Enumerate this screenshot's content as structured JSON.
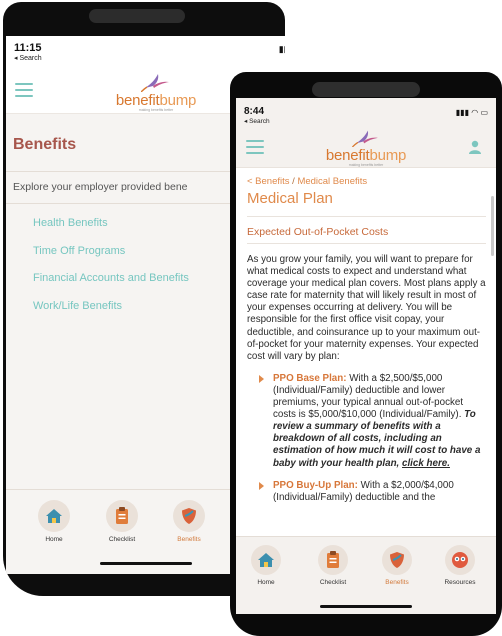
{
  "back_screen": {
    "status": {
      "time": "11:15",
      "back_label": "◂ Search"
    },
    "brand": {
      "name_part1": "benefit",
      "name_part2": "bump",
      "tagline": "making benefits better"
    },
    "page_title": "Benefits",
    "intro": "Explore your employer provided bene",
    "menu_items": [
      "Health Benefits",
      "Time Off Programs",
      "Financial Accounts and Benefits",
      "Work/Life Benefits"
    ],
    "tabs": [
      {
        "label": "Home",
        "icon": "house-icon"
      },
      {
        "label": "Checklist",
        "icon": "clipboard-icon"
      },
      {
        "label": "Benefits",
        "icon": "shield-icon",
        "active": true
      }
    ]
  },
  "front_screen": {
    "status": {
      "time": "8:44",
      "back_label": "◂ Search"
    },
    "brand": {
      "name_part1": "benefit",
      "name_part2": "bump",
      "tagline": "making benefits better"
    },
    "breadcrumb": {
      "parent": "< Benefits",
      "separator": "/",
      "current": "Medical Benefits"
    },
    "page_title": "Medical Plan",
    "section_title": "Expected Out-of-Pocket Costs",
    "paragraph": "As you grow your family, you will want to prepare for what medical costs to expect and understand what coverage your medical plan covers. Most plans apply a case rate for maternity that will likely result in most of your expenses occurring at delivery. You will be responsible for the first office visit copay, your deductible, and coinsurance up to your maximum out-of-pocket for your maternity expenses. Your expected cost will vary by plan:",
    "plans": [
      {
        "name": "PPO Base Plan:",
        "text": " With a $2,500/$5,000 (Individual/Family) deductible and lower premiums, your typical annual out-of-pocket costs is $5,000/$10,000 (Individual/Family). ",
        "emphasis": "To review a summary of benefits with a breakdown of all costs, including an estimation of how much it will cost to have a baby with your health plan, ",
        "link": "click here."
      },
      {
        "name": "PPO Buy-Up Plan:",
        "text": " With a $2,000/$4,000 (Individual/Family) deductible and the"
      }
    ],
    "tabs": [
      {
        "label": "Home",
        "icon": "house-icon"
      },
      {
        "label": "Checklist",
        "icon": "clipboard-icon"
      },
      {
        "label": "Benefits",
        "icon": "shield-icon",
        "active": true
      },
      {
        "label": "Resources",
        "icon": "resources-icon"
      }
    ]
  },
  "colors": {
    "brand_orange": "#d8782f",
    "teal": "#76c6c0",
    "title_red": "#a7564c",
    "tab_circle": "#eae1d9"
  }
}
